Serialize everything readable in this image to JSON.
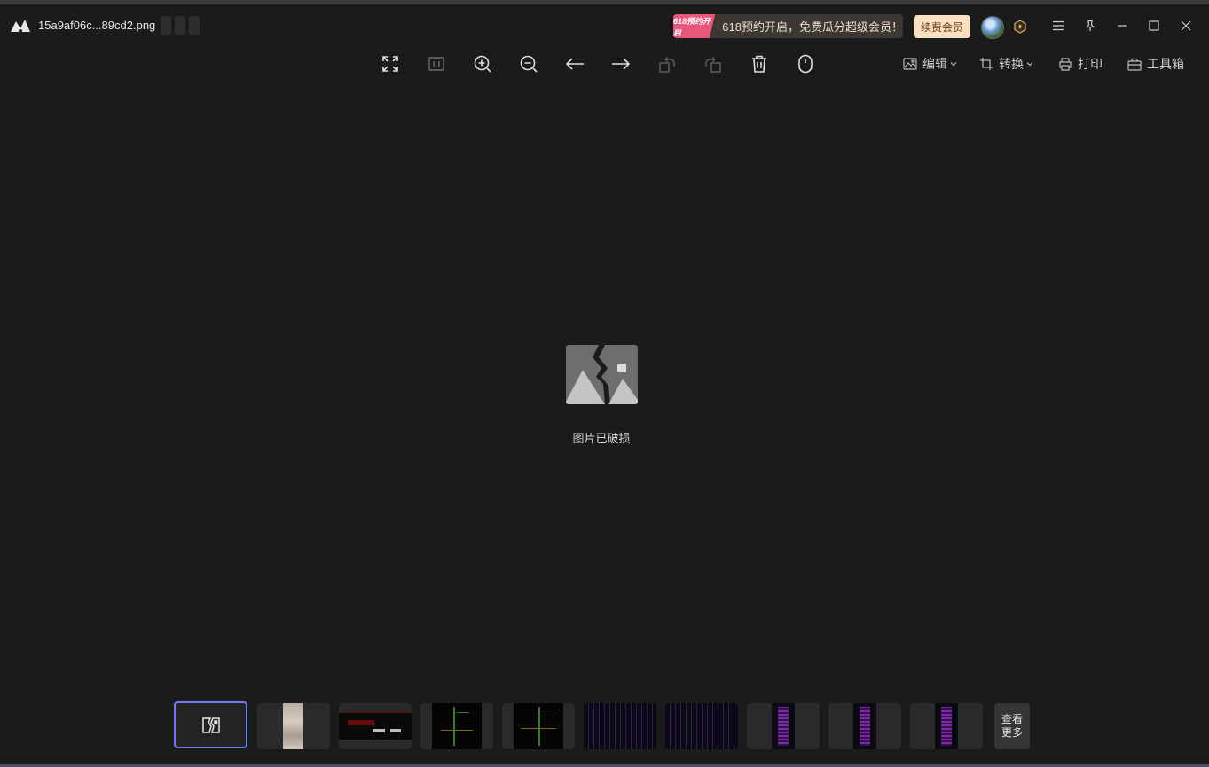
{
  "titlebar": {
    "filename": "15a9af06c...89cd2.png",
    "promo_tag": "618预约开启",
    "promo_text": "618预约开启，免费瓜分超级会员！",
    "renew_label": "续费会员"
  },
  "toolbar": {
    "edit_label": "编辑",
    "convert_label": "转换",
    "print_label": "打印",
    "toolbox_label": "工具箱"
  },
  "viewer": {
    "status_text": "图片已破损"
  },
  "thumbnails": {
    "more_label_line1": "查看",
    "more_label_line2": "更多"
  },
  "colors": {
    "background": "#1b1b1b",
    "accent_selected": "#6e7cf0",
    "promo_pink": "#e8567c",
    "renew_bg": "#fbe1c4"
  },
  "icons": [
    "app-logo-icon",
    "fullscreen-icon",
    "actual-size-icon",
    "zoom-in-icon",
    "zoom-out-icon",
    "previous-icon",
    "next-icon",
    "rotate-left-icon",
    "rotate-right-icon",
    "delete-icon",
    "mouse-icon",
    "edit-icon",
    "convert-icon",
    "print-icon",
    "toolbox-icon",
    "menu-icon",
    "pin-icon",
    "minimize-icon",
    "maximize-icon",
    "close-icon",
    "broken-image-icon"
  ]
}
